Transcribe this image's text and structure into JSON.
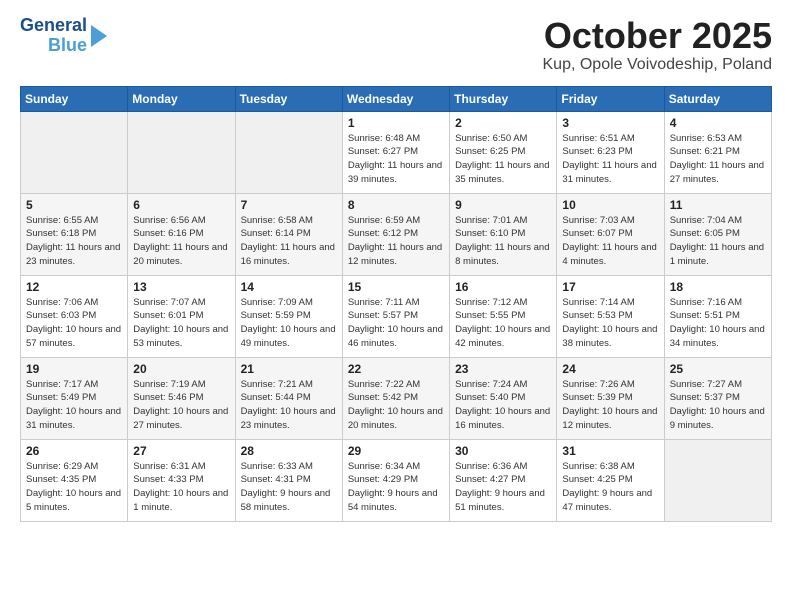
{
  "header": {
    "logo_general": "General",
    "logo_blue": "Blue",
    "month": "October 2025",
    "location": "Kup, Opole Voivodeship, Poland"
  },
  "weekdays": [
    "Sunday",
    "Monday",
    "Tuesday",
    "Wednesday",
    "Thursday",
    "Friday",
    "Saturday"
  ],
  "weeks": [
    [
      {
        "day": "",
        "sunrise": "",
        "sunset": "",
        "daylight": ""
      },
      {
        "day": "",
        "sunrise": "",
        "sunset": "",
        "daylight": ""
      },
      {
        "day": "",
        "sunrise": "",
        "sunset": "",
        "daylight": ""
      },
      {
        "day": "1",
        "sunrise": "Sunrise: 6:48 AM",
        "sunset": "Sunset: 6:27 PM",
        "daylight": "Daylight: 11 hours and 39 minutes."
      },
      {
        "day": "2",
        "sunrise": "Sunrise: 6:50 AM",
        "sunset": "Sunset: 6:25 PM",
        "daylight": "Daylight: 11 hours and 35 minutes."
      },
      {
        "day": "3",
        "sunrise": "Sunrise: 6:51 AM",
        "sunset": "Sunset: 6:23 PM",
        "daylight": "Daylight: 11 hours and 31 minutes."
      },
      {
        "day": "4",
        "sunrise": "Sunrise: 6:53 AM",
        "sunset": "Sunset: 6:21 PM",
        "daylight": "Daylight: 11 hours and 27 minutes."
      }
    ],
    [
      {
        "day": "5",
        "sunrise": "Sunrise: 6:55 AM",
        "sunset": "Sunset: 6:18 PM",
        "daylight": "Daylight: 11 hours and 23 minutes."
      },
      {
        "day": "6",
        "sunrise": "Sunrise: 6:56 AM",
        "sunset": "Sunset: 6:16 PM",
        "daylight": "Daylight: 11 hours and 20 minutes."
      },
      {
        "day": "7",
        "sunrise": "Sunrise: 6:58 AM",
        "sunset": "Sunset: 6:14 PM",
        "daylight": "Daylight: 11 hours and 16 minutes."
      },
      {
        "day": "8",
        "sunrise": "Sunrise: 6:59 AM",
        "sunset": "Sunset: 6:12 PM",
        "daylight": "Daylight: 11 hours and 12 minutes."
      },
      {
        "day": "9",
        "sunrise": "Sunrise: 7:01 AM",
        "sunset": "Sunset: 6:10 PM",
        "daylight": "Daylight: 11 hours and 8 minutes."
      },
      {
        "day": "10",
        "sunrise": "Sunrise: 7:03 AM",
        "sunset": "Sunset: 6:07 PM",
        "daylight": "Daylight: 11 hours and 4 minutes."
      },
      {
        "day": "11",
        "sunrise": "Sunrise: 7:04 AM",
        "sunset": "Sunset: 6:05 PM",
        "daylight": "Daylight: 11 hours and 1 minute."
      }
    ],
    [
      {
        "day": "12",
        "sunrise": "Sunrise: 7:06 AM",
        "sunset": "Sunset: 6:03 PM",
        "daylight": "Daylight: 10 hours and 57 minutes."
      },
      {
        "day": "13",
        "sunrise": "Sunrise: 7:07 AM",
        "sunset": "Sunset: 6:01 PM",
        "daylight": "Daylight: 10 hours and 53 minutes."
      },
      {
        "day": "14",
        "sunrise": "Sunrise: 7:09 AM",
        "sunset": "Sunset: 5:59 PM",
        "daylight": "Daylight: 10 hours and 49 minutes."
      },
      {
        "day": "15",
        "sunrise": "Sunrise: 7:11 AM",
        "sunset": "Sunset: 5:57 PM",
        "daylight": "Daylight: 10 hours and 46 minutes."
      },
      {
        "day": "16",
        "sunrise": "Sunrise: 7:12 AM",
        "sunset": "Sunset: 5:55 PM",
        "daylight": "Daylight: 10 hours and 42 minutes."
      },
      {
        "day": "17",
        "sunrise": "Sunrise: 7:14 AM",
        "sunset": "Sunset: 5:53 PM",
        "daylight": "Daylight: 10 hours and 38 minutes."
      },
      {
        "day": "18",
        "sunrise": "Sunrise: 7:16 AM",
        "sunset": "Sunset: 5:51 PM",
        "daylight": "Daylight: 10 hours and 34 minutes."
      }
    ],
    [
      {
        "day": "19",
        "sunrise": "Sunrise: 7:17 AM",
        "sunset": "Sunset: 5:49 PM",
        "daylight": "Daylight: 10 hours and 31 minutes."
      },
      {
        "day": "20",
        "sunrise": "Sunrise: 7:19 AM",
        "sunset": "Sunset: 5:46 PM",
        "daylight": "Daylight: 10 hours and 27 minutes."
      },
      {
        "day": "21",
        "sunrise": "Sunrise: 7:21 AM",
        "sunset": "Sunset: 5:44 PM",
        "daylight": "Daylight: 10 hours and 23 minutes."
      },
      {
        "day": "22",
        "sunrise": "Sunrise: 7:22 AM",
        "sunset": "Sunset: 5:42 PM",
        "daylight": "Daylight: 10 hours and 20 minutes."
      },
      {
        "day": "23",
        "sunrise": "Sunrise: 7:24 AM",
        "sunset": "Sunset: 5:40 PM",
        "daylight": "Daylight: 10 hours and 16 minutes."
      },
      {
        "day": "24",
        "sunrise": "Sunrise: 7:26 AM",
        "sunset": "Sunset: 5:39 PM",
        "daylight": "Daylight: 10 hours and 12 minutes."
      },
      {
        "day": "25",
        "sunrise": "Sunrise: 7:27 AM",
        "sunset": "Sunset: 5:37 PM",
        "daylight": "Daylight: 10 hours and 9 minutes."
      }
    ],
    [
      {
        "day": "26",
        "sunrise": "Sunrise: 6:29 AM",
        "sunset": "Sunset: 4:35 PM",
        "daylight": "Daylight: 10 hours and 5 minutes."
      },
      {
        "day": "27",
        "sunrise": "Sunrise: 6:31 AM",
        "sunset": "Sunset: 4:33 PM",
        "daylight": "Daylight: 10 hours and 1 minute."
      },
      {
        "day": "28",
        "sunrise": "Sunrise: 6:33 AM",
        "sunset": "Sunset: 4:31 PM",
        "daylight": "Daylight: 9 hours and 58 minutes."
      },
      {
        "day": "29",
        "sunrise": "Sunrise: 6:34 AM",
        "sunset": "Sunset: 4:29 PM",
        "daylight": "Daylight: 9 hours and 54 minutes."
      },
      {
        "day": "30",
        "sunrise": "Sunrise: 6:36 AM",
        "sunset": "Sunset: 4:27 PM",
        "daylight": "Daylight: 9 hours and 51 minutes."
      },
      {
        "day": "31",
        "sunrise": "Sunrise: 6:38 AM",
        "sunset": "Sunset: 4:25 PM",
        "daylight": "Daylight: 9 hours and 47 minutes."
      },
      {
        "day": "",
        "sunrise": "",
        "sunset": "",
        "daylight": ""
      }
    ]
  ]
}
